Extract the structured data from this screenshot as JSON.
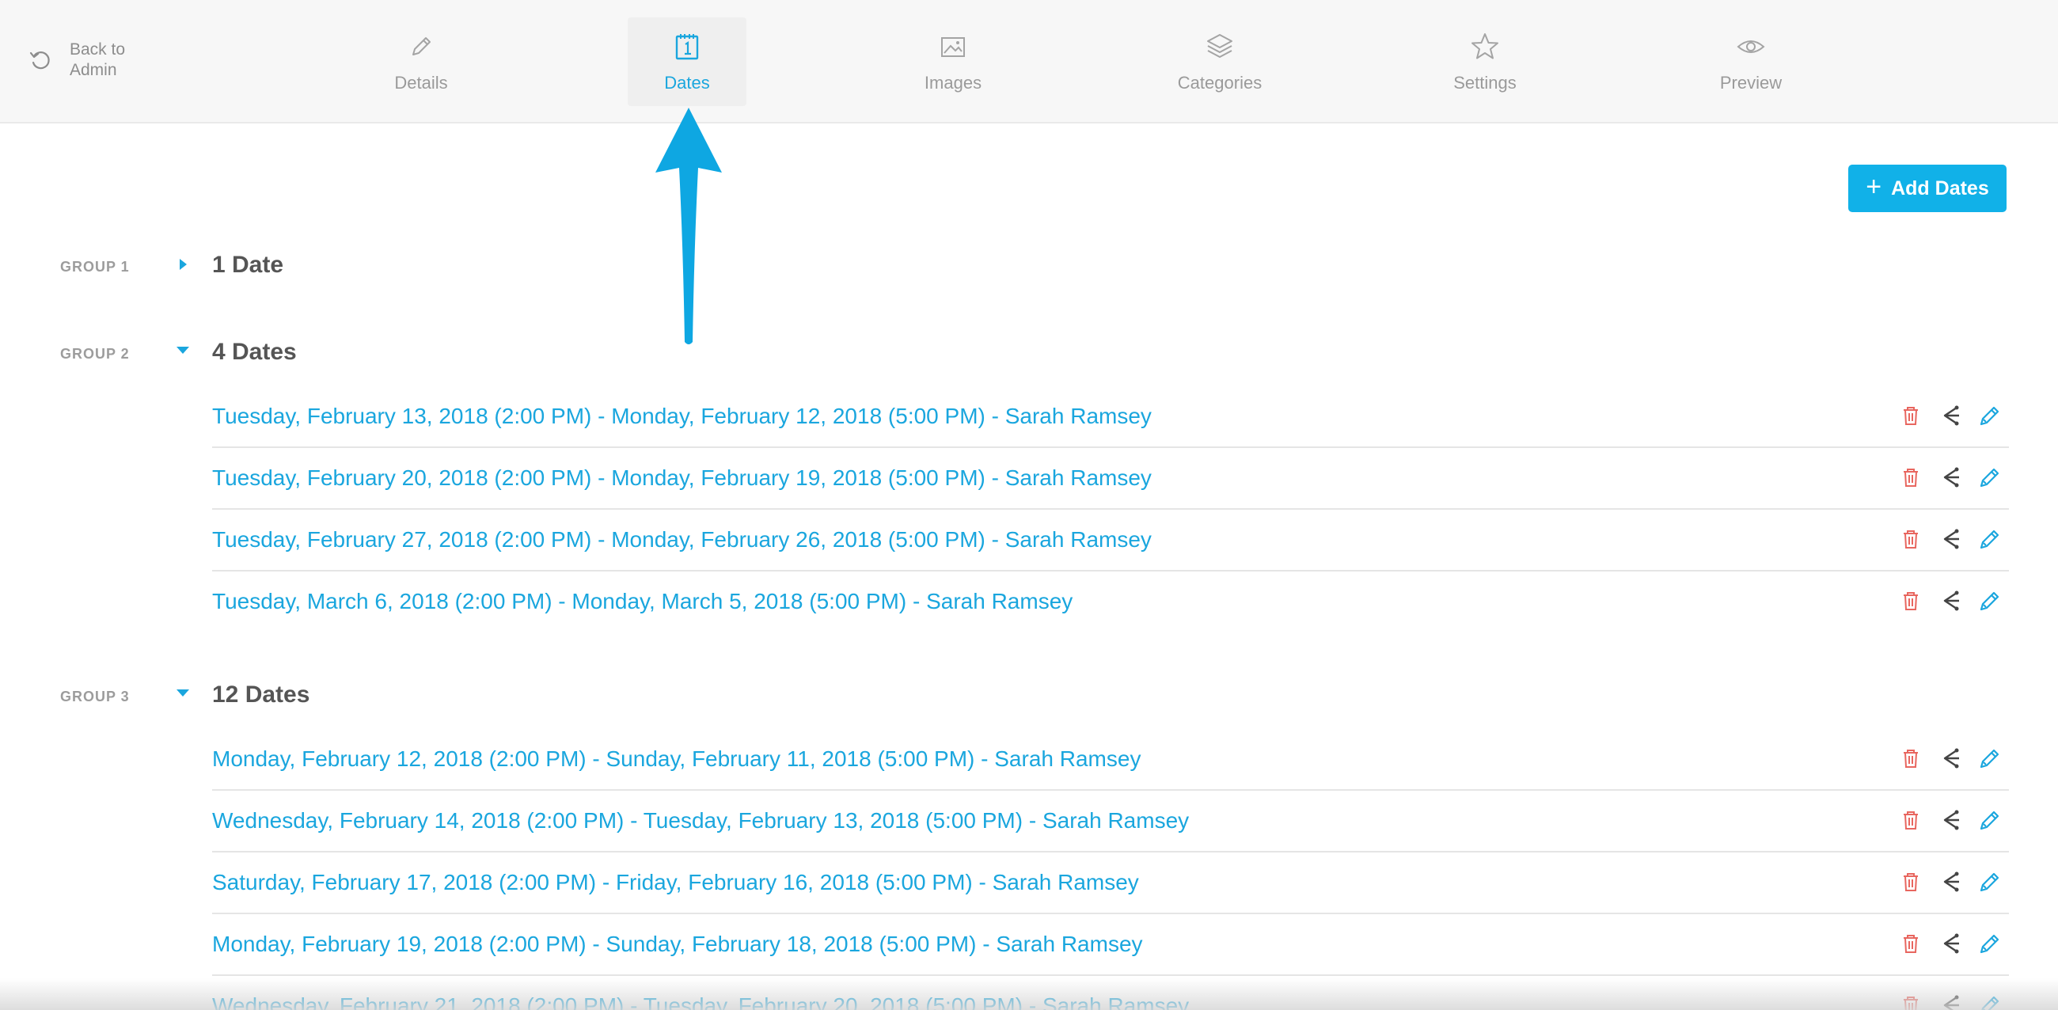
{
  "nav": {
    "back_label": "Back to Admin",
    "tabs": [
      {
        "label": "Details",
        "icon": "pencil-icon"
      },
      {
        "label": "Dates",
        "icon": "calendar-icon",
        "active": true
      },
      {
        "label": "Images",
        "icon": "image-icon"
      },
      {
        "label": "Categories",
        "icon": "layers-icon"
      },
      {
        "label": "Settings",
        "icon": "star-icon"
      },
      {
        "label": "Preview",
        "icon": "eye-icon"
      }
    ]
  },
  "add_button": {
    "label": "Add Dates"
  },
  "groups": [
    {
      "label": "GROUP 1",
      "title": "1 Date",
      "expanded": false,
      "rows": []
    },
    {
      "label": "GROUP 2",
      "title": "4 Dates",
      "expanded": true,
      "rows": [
        "Tuesday, February 13, 2018 (2:00 PM) - Monday, February 12, 2018 (5:00 PM) - Sarah Ramsey",
        "Tuesday, February 20, 2018 (2:00 PM) - Monday, February 19, 2018 (5:00 PM) - Sarah Ramsey",
        "Tuesday, February 27, 2018 (2:00 PM) - Monday, February 26, 2018 (5:00 PM) - Sarah Ramsey",
        "Tuesday, March 6, 2018 (2:00 PM) - Monday, March 5, 2018 (5:00 PM) - Sarah Ramsey"
      ]
    },
    {
      "label": "GROUP 3",
      "title": "12 Dates",
      "expanded": true,
      "rows": [
        "Monday, February 12, 2018 (2:00 PM) - Sunday, February 11, 2018 (5:00 PM) - Sarah Ramsey",
        "Wednesday, February 14, 2018 (2:00 PM) - Tuesday, February 13, 2018 (5:00 PM) - Sarah Ramsey",
        "Saturday, February 17, 2018 (2:00 PM) - Friday, February 16, 2018 (5:00 PM) - Sarah Ramsey",
        "Monday, February 19, 2018 (2:00 PM) - Sunday, February 18, 2018 (5:00 PM) - Sarah Ramsey",
        "Wednesday, February 21, 2018 (2:00 PM) - Tuesday, February 20, 2018 (5:00 PM) - Sarah Ramsey"
      ]
    }
  ],
  "row_actions": [
    "trash-icon",
    "share-icon",
    "pencil-icon"
  ],
  "colors": {
    "accent": "#11b1e8",
    "link": "#1aa6de",
    "danger": "#e8665f",
    "muted": "#9a9a9a"
  }
}
